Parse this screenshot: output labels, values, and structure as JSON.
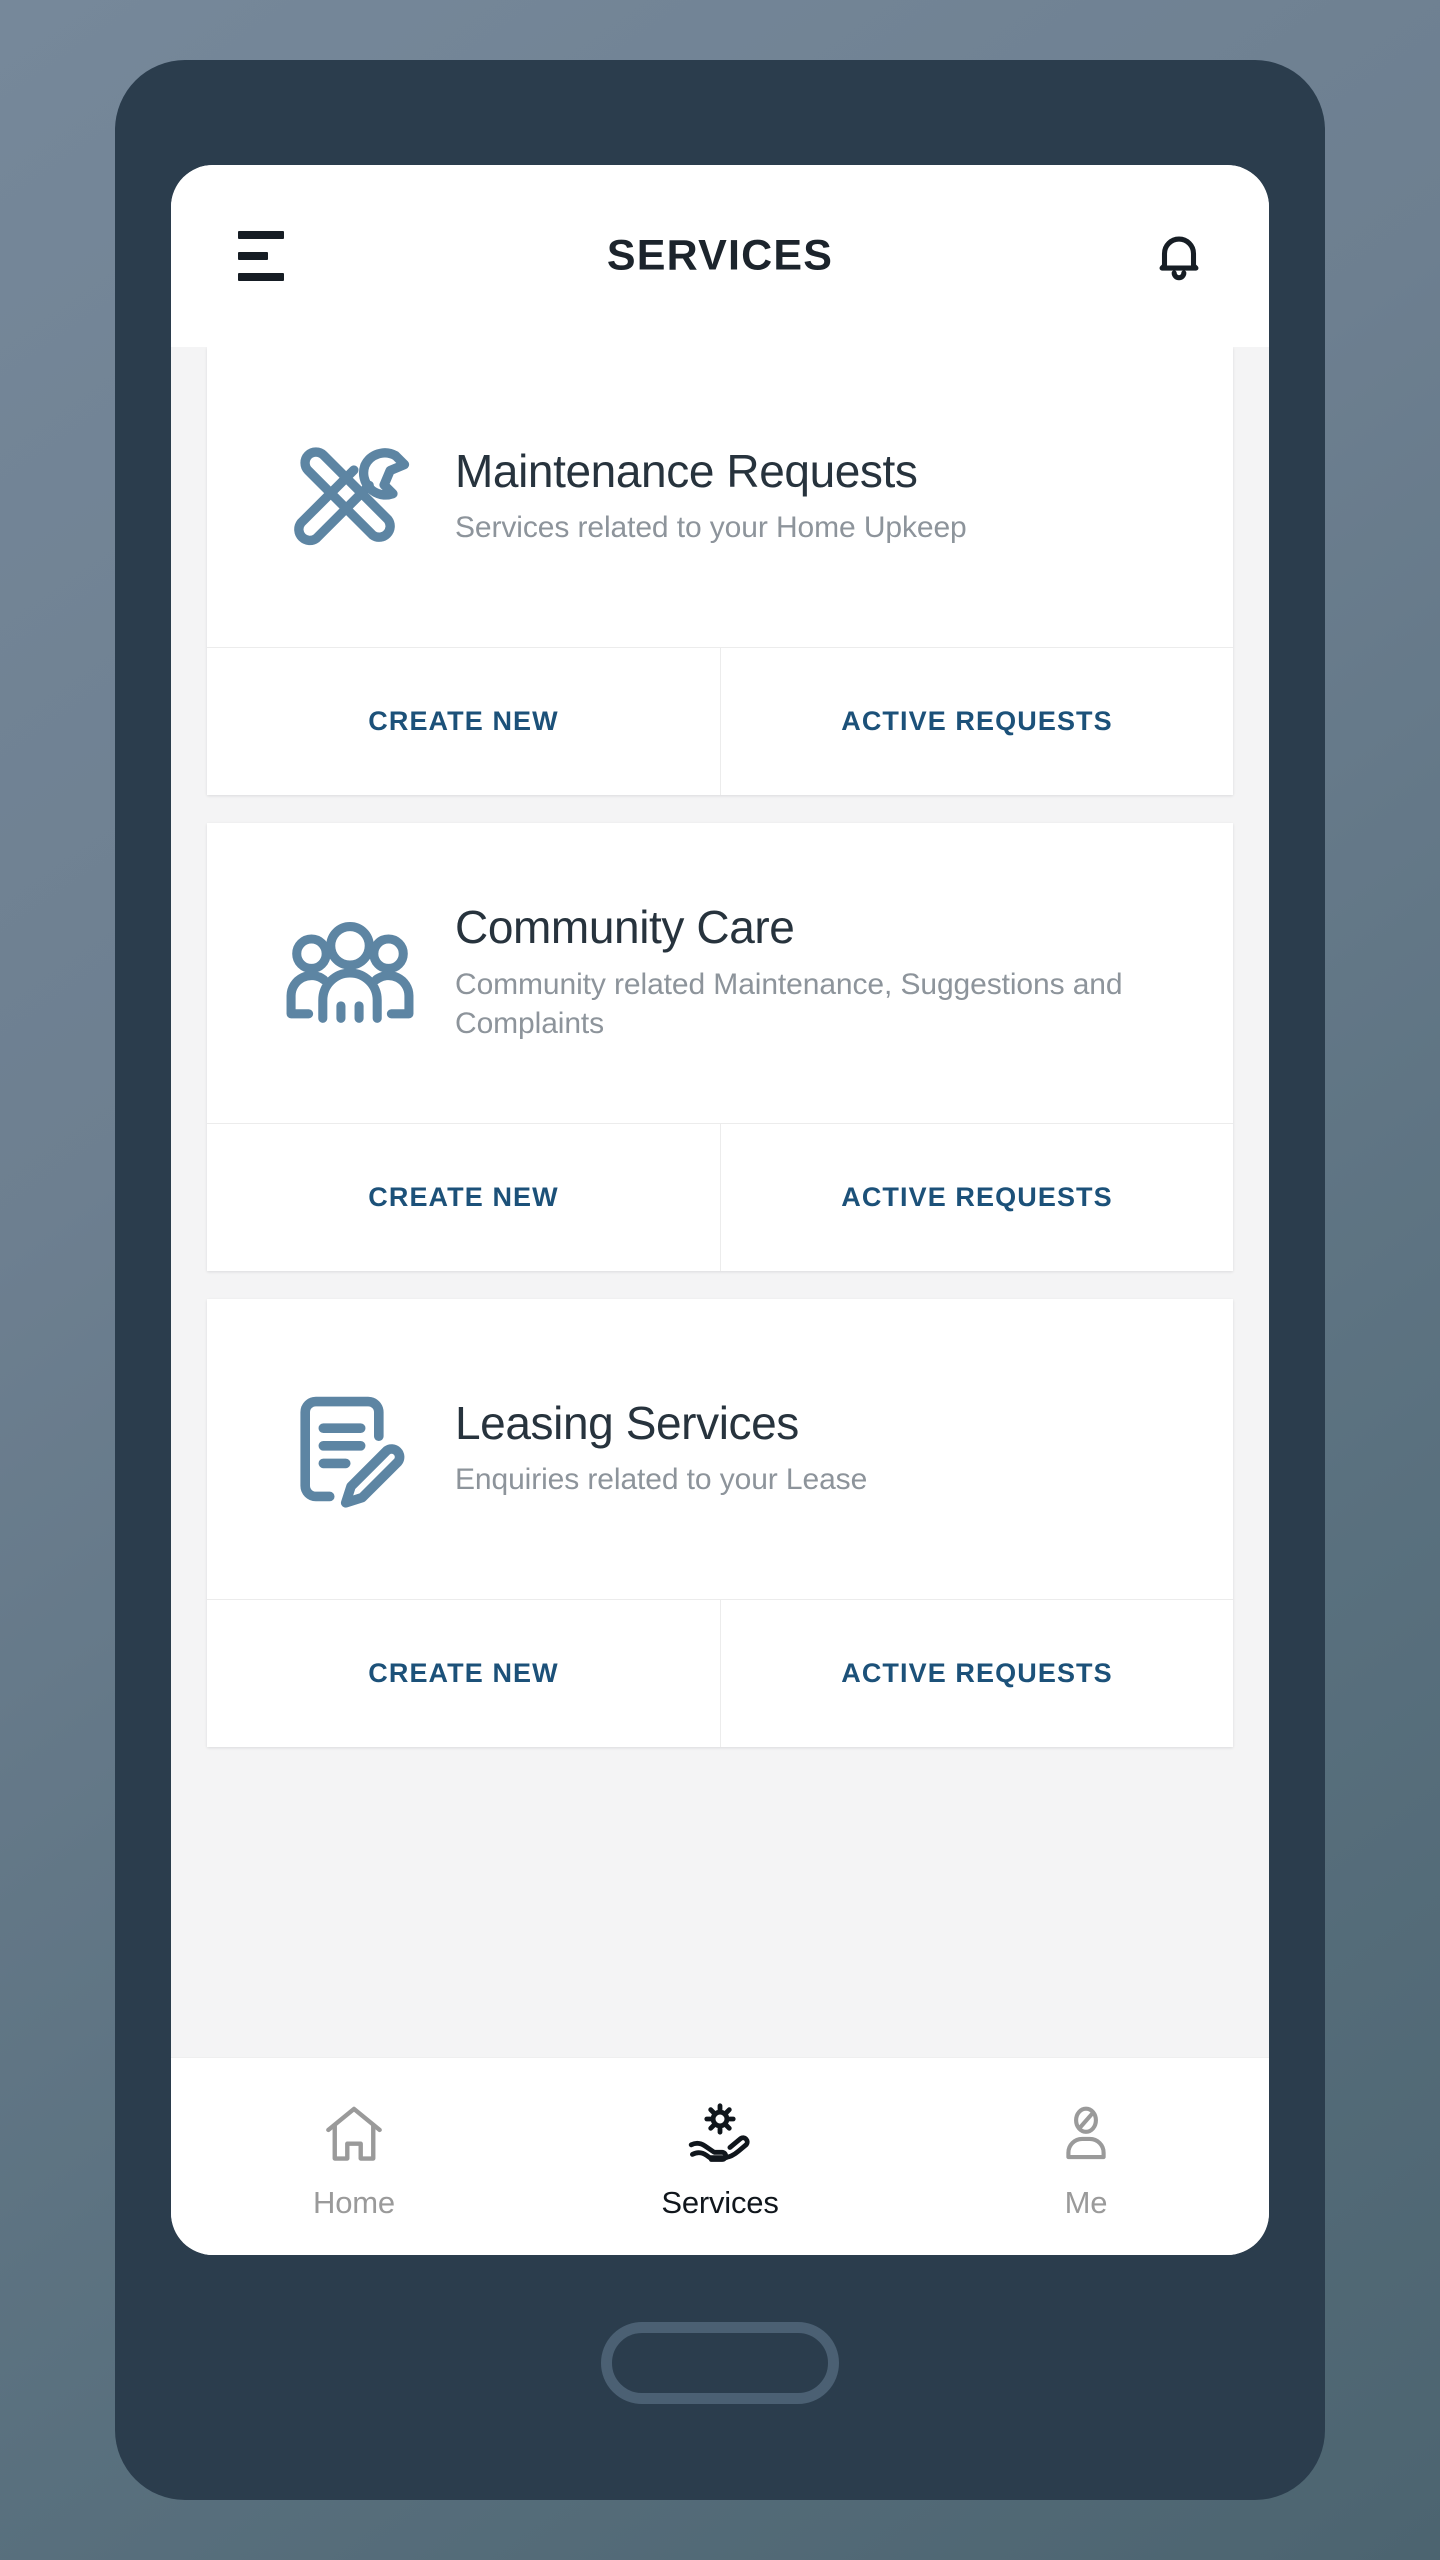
{
  "appbar": {
    "menu_icon": "hamburger-menu-icon",
    "title": "SERVICES",
    "notification_icon": "bell-icon"
  },
  "colors": {
    "background_slate": "#6d7f90",
    "phone_frame": "#2b3d4d",
    "card_icon": "#5d85a3",
    "action_link": "#1c5179",
    "title_text": "#27333d",
    "subtitle_text": "#8d949b",
    "content_bg": "#f4f4f5"
  },
  "cards": [
    {
      "icon": "wrench-screwdriver-icon",
      "title": "Maintenance Requests",
      "subtitle": "Services related to your Home Upkeep",
      "actions": [
        {
          "label": "CREATE NEW"
        },
        {
          "label": "ACTIVE REQUESTS"
        }
      ]
    },
    {
      "icon": "people-group-icon",
      "title": "Community Care",
      "subtitle": "Community related Maintenance, Suggestions and Complaints",
      "actions": [
        {
          "label": "CREATE NEW"
        },
        {
          "label": "ACTIVE REQUESTS"
        }
      ]
    },
    {
      "icon": "document-pencil-icon",
      "title": "Leasing Services",
      "subtitle": "Enquiries related to your Lease",
      "actions": [
        {
          "label": "CREATE NEW"
        },
        {
          "label": "ACTIVE REQUESTS"
        }
      ]
    }
  ],
  "bottom_nav": {
    "items": [
      {
        "label": "Home",
        "icon": "home-icon",
        "active": false
      },
      {
        "label": "Services",
        "icon": "gear-on-hand-icon",
        "active": true
      },
      {
        "label": "Me",
        "icon": "person-icon",
        "active": false
      }
    ]
  }
}
